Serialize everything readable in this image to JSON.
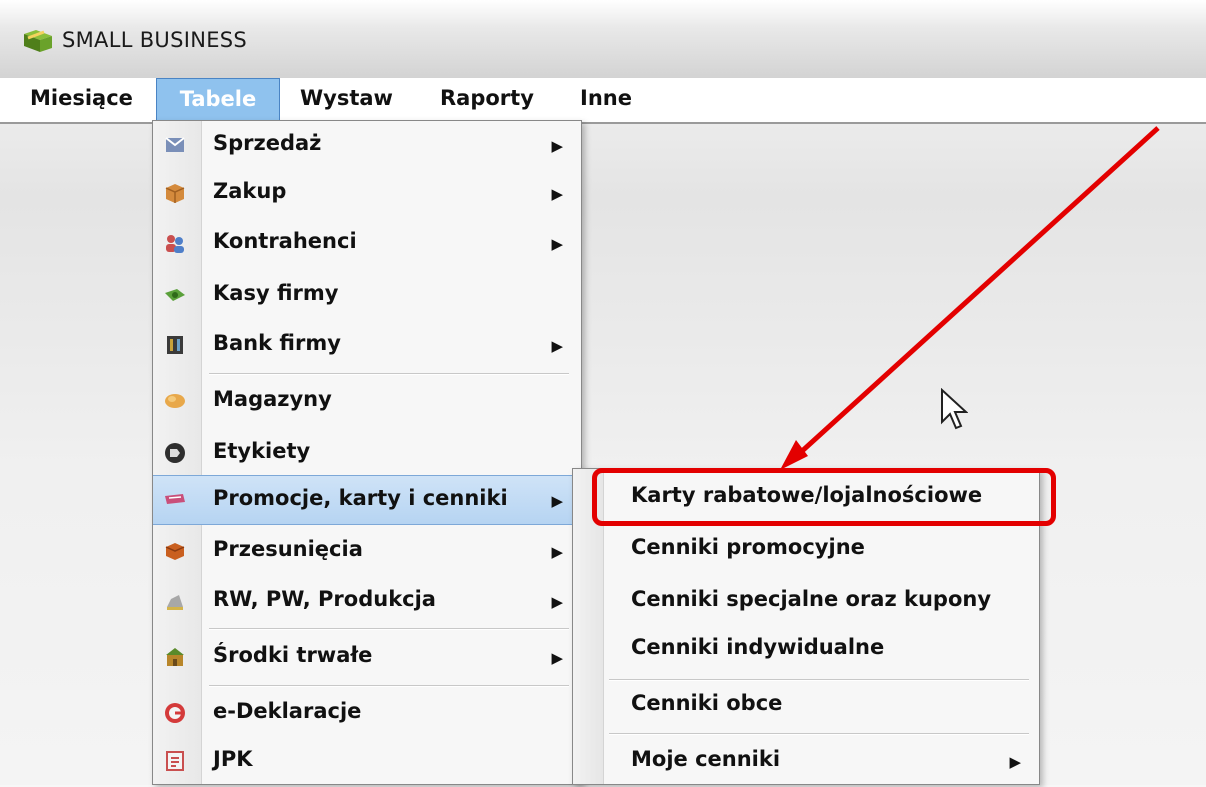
{
  "window": {
    "title": "SMALL BUSINESS"
  },
  "menubar": {
    "items": [
      {
        "label": "Miesiące"
      },
      {
        "label": "Tabele"
      },
      {
        "label": "Wystaw"
      },
      {
        "label": "Raporty"
      },
      {
        "label": "Inne"
      }
    ]
  },
  "tabele_menu": {
    "items": [
      {
        "label": "Sprzedaż",
        "icon": "sales-icon",
        "submenu": true
      },
      {
        "label": "Zakup",
        "icon": "package-icon",
        "submenu": true
      },
      {
        "label": "Kontrahenci",
        "icon": "contacts-icon",
        "submenu": true
      },
      {
        "label": "Kasy firmy",
        "icon": "cash-icon",
        "submenu": false
      },
      {
        "label": "Bank firmy",
        "icon": "bank-icon",
        "submenu": true
      },
      {
        "label": "Magazyny",
        "icon": "warehouse-icon",
        "submenu": false
      },
      {
        "label": "Etykiety",
        "icon": "label-icon",
        "submenu": false
      },
      {
        "label": "Promocje, karty i cenniki",
        "icon": "promotions-icon",
        "submenu": true,
        "highlighted": true
      },
      {
        "label": "Przesunięcia",
        "icon": "transfer-icon",
        "submenu": true
      },
      {
        "label": "RW, PW, Produkcja",
        "icon": "production-icon",
        "submenu": true
      },
      {
        "label": "Środki trwałe",
        "icon": "fixed-assets-icon",
        "submenu": true
      },
      {
        "label": "e-Deklaracje",
        "icon": "e-declarations-icon",
        "submenu": false
      },
      {
        "label": "JPK",
        "icon": "jpk-icon",
        "submenu": false
      }
    ]
  },
  "submenu": {
    "items": [
      {
        "label": "Karty rabatowe/lojalnościowe",
        "submenu": false
      },
      {
        "label": "Cenniki promocyjne",
        "submenu": false
      },
      {
        "label": "Cenniki specjalne oraz kupony",
        "submenu": false
      },
      {
        "label": "Cenniki indywidualne",
        "submenu": false
      },
      {
        "label": "Cenniki obce",
        "submenu": false
      },
      {
        "label": "Moje cenniki",
        "submenu": true
      }
    ]
  },
  "annotation": {
    "color": "#e30000"
  },
  "colors": {
    "menu_highlight": "#8fc2ee",
    "item_highlight": "#b6d4f2"
  }
}
